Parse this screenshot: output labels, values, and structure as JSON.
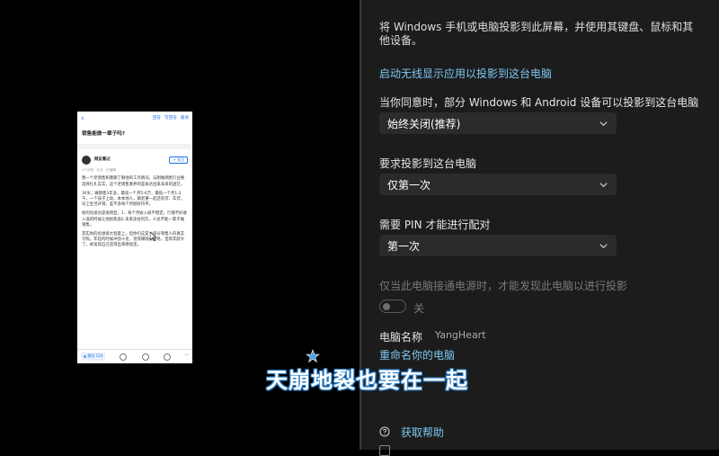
{
  "phone": {
    "actions": [
      "回答",
      "写回答",
      "邀请"
    ],
    "question_title": "销售能做一辈子吗?",
    "author_name": "网友看过",
    "follow_label": "+ 关注",
    "meta": "2个月前 · 北京 · 已编辑",
    "paragraphs": [
      "我一个老销售和我聊了聊他的工作情况，与刚做销售行业要选择扎扎实实，这个老销售素养的是表达出来未来的迷茫。",
      "30岁，做销售3年多，最高一个月5-6万，最低一个月1-2千，一个孩子上幼，本本地人，跟老婆一起还房贷、车贷，早上生活开销，差不多每个月刚好持平。",
      "他的忧虑也是很明显，1、每个月收入很不稳定，行情不好收入低的时候让他很焦虑2.未来该往何方，人总不能一辈子做销售。",
      "其实他的忧虑很大程度上，但你们这是大部分销售人的真实写照，年轻的时候冲劲十足，觉得赚钱很容易，但等年龄大了，却发现自己还得出来继续还。"
    ],
    "bottom_agree": "▲ 赞同 124",
    "bottom_more": "···"
  },
  "settings": {
    "description": "将 Windows 手机或电脑投影到此屏幕，并使用其键盘、鼠标和其他设备。",
    "launch_link": "启动无线显示应用以投影到这台电脑",
    "permission_label": "当你同意时，部分 Windows 和 Android 设备可以投影到这台电脑",
    "permission_value": "始终关闭(推荐)",
    "ask_label": "要求投影到这台电脑",
    "ask_value": "仅第一次",
    "pin_label": "需要 PIN 才能进行配对",
    "pin_value": "第一次",
    "power_label": "仅当此电脑接通电源时，才能发现此电脑以进行投影",
    "toggle_state": "关",
    "pc_name_label": "电脑名称",
    "pc_name_value": "YangHeart",
    "rename_link": "重命名你的电脑",
    "help_label": "获取帮助"
  },
  "subtitle": "天崩地裂也要在一起",
  "colors": {
    "link": "#7cc7f2",
    "panel_bg": "#1c1c1c",
    "dropdown_bg": "#2b2b2b",
    "subtitle_outline": "#2f7fc6"
  }
}
